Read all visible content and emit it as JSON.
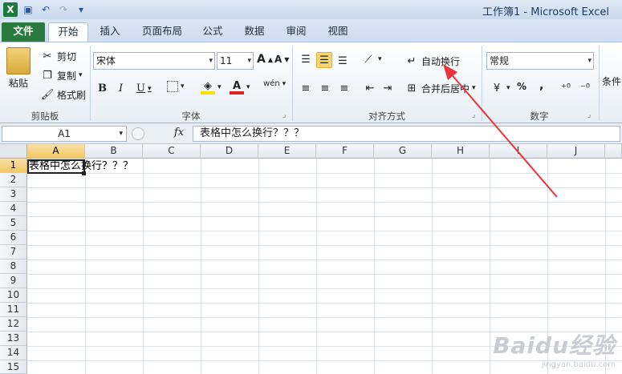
{
  "window": {
    "title": "工作簿1 - Microsoft Excel"
  },
  "qat": [
    {
      "name": "excel-icon",
      "glyph": "X"
    },
    {
      "name": "save-icon",
      "glyph": "▣"
    },
    {
      "name": "undo-icon",
      "glyph": "↶"
    },
    {
      "name": "redo-icon",
      "glyph": "↷"
    },
    {
      "name": "customize-qat-icon",
      "glyph": "▾"
    }
  ],
  "tabs": [
    "文件",
    "开始",
    "插入",
    "页面布局",
    "公式",
    "数据",
    "审阅",
    "视图"
  ],
  "ribbon": {
    "clipboard": {
      "paste": "粘贴",
      "cut": "剪切",
      "copy": "复制",
      "format_painter": "格式刷",
      "label": "剪贴板"
    },
    "font": {
      "name": "宋体",
      "size": "11",
      "grow": "A",
      "shrink": "A",
      "bold": "B",
      "italic": "I",
      "underline": "U",
      "font_color": "A",
      "phonetic": "wén",
      "label": "字体"
    },
    "alignment": {
      "wrap_text": "自动换行",
      "merge_center": "合并后居中",
      "label": "对齐方式"
    },
    "number": {
      "format": "常规",
      "percent": "%",
      "comma": ",",
      "label": "数字"
    },
    "styles": {
      "conditional": "条件"
    }
  },
  "formula_bar": {
    "name_box": "A1",
    "fx": "fx",
    "content": "表格中怎么换行？？？"
  },
  "sheet": {
    "columns": [
      "A",
      "B",
      "C",
      "D",
      "E",
      "F",
      "G",
      "H",
      "I",
      "J"
    ],
    "rows": [
      "1",
      "2",
      "3",
      "4",
      "5",
      "6",
      "7",
      "8",
      "9",
      "10",
      "11",
      "12",
      "13",
      "14",
      "15"
    ],
    "selected_cell": "A1",
    "a1_value": "表格中怎么换行？？？"
  },
  "watermark": {
    "logo": "Baidu经验",
    "url": "jingyan.baidu.com"
  },
  "colors": {
    "file_tab": "#2a7a3e",
    "selection_header": "#f3c766",
    "annotation_arrow": "#e8343a"
  }
}
